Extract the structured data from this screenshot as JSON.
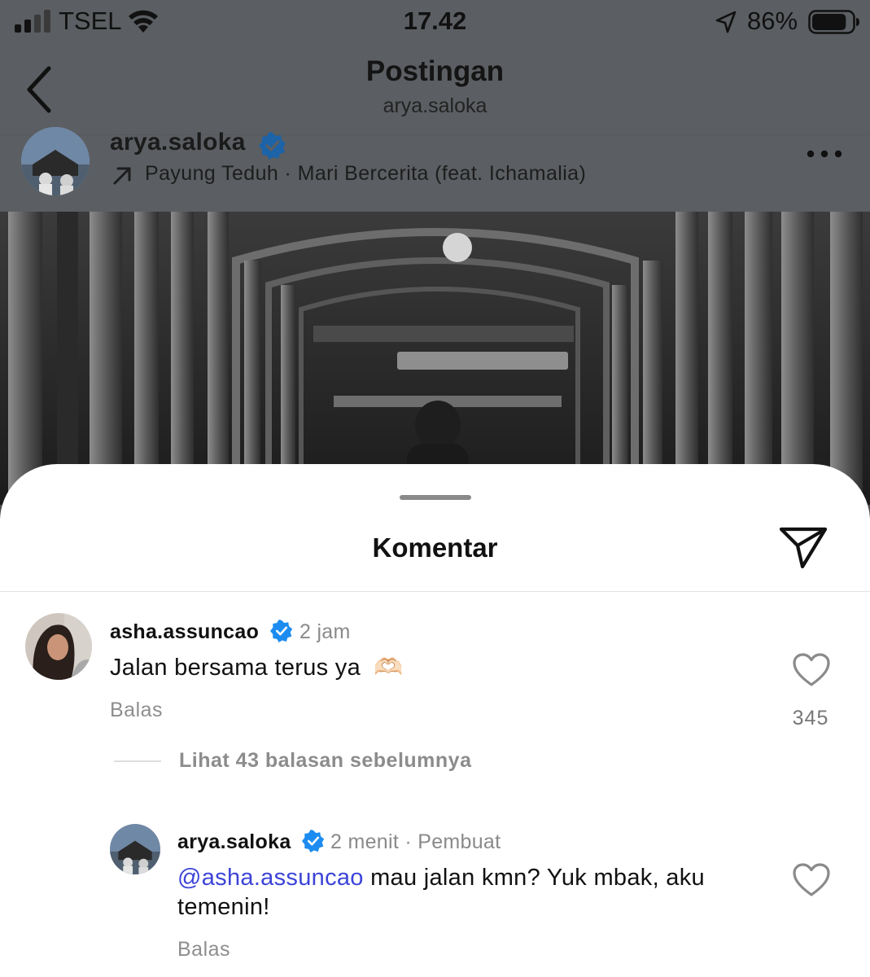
{
  "status_bar": {
    "carrier": "TSEL",
    "time": "17.42",
    "battery_percent": "86%",
    "battery_level": 0.86,
    "signal_bars": 2
  },
  "header": {
    "title": "Postingan",
    "subtitle": "arya.saloka"
  },
  "post": {
    "username": "arya.saloka",
    "verified": true,
    "music": "Payung Teduh · Mari Bercerita (feat. Ichamalia)",
    "more_icon": "more-horizontal-icon"
  },
  "comments_sheet": {
    "title": "Komentar",
    "share_icon": "send-icon",
    "comments": [
      {
        "username": "asha.assuncao",
        "verified": true,
        "time": "2 jam",
        "text": "Jalan bersama terus ya",
        "emoji": "🫶🏻",
        "reply_label": "Balas",
        "like_count": "345"
      }
    ],
    "view_replies": "Lihat 43 balasan sebelumnya",
    "reply": {
      "username": "arya.saloka",
      "verified": true,
      "time": "2 menit",
      "author_tag": "· Pembuat",
      "mention": "@asha.assuncao",
      "text_line1": " mau jalan kmn? Yuk mbak, aku",
      "text_line2": "temenin!",
      "reply_label": "Balas"
    }
  },
  "colors": {
    "verified_blue": "#1d8cf0",
    "mention_blue": "#3c44d8",
    "overlay": "#5b5e62"
  }
}
